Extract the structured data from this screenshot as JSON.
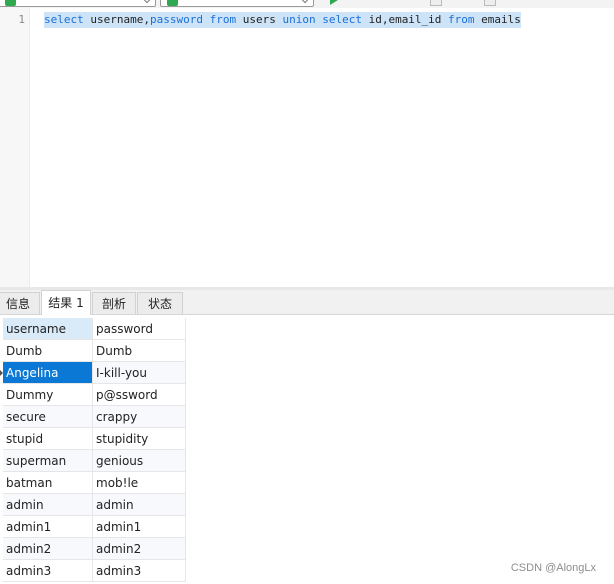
{
  "editor": {
    "line_number": "1",
    "tokens": [
      {
        "text": "select",
        "kind": "kw"
      },
      {
        "text": " username,",
        "kind": "id"
      },
      {
        "text": "password",
        "kind": "kw"
      },
      {
        "text": " ",
        "kind": "id"
      },
      {
        "text": "from",
        "kind": "kw"
      },
      {
        "text": " users ",
        "kind": "id"
      },
      {
        "text": "union",
        "kind": "kw"
      },
      {
        "text": " ",
        "kind": "id"
      },
      {
        "text": "select",
        "kind": "kw"
      },
      {
        "text": " id,email_id ",
        "kind": "id"
      },
      {
        "text": "from",
        "kind": "kw"
      },
      {
        "text": " emails",
        "kind": "id"
      }
    ],
    "keyword_color": "#1a6fd6",
    "selection_color": "#cde4f8"
  },
  "tabs": [
    {
      "label": "信息",
      "active": false
    },
    {
      "label": "结果 1",
      "active": true
    },
    {
      "label": "剖析",
      "active": false
    },
    {
      "label": "状态",
      "active": false
    }
  ],
  "result": {
    "columns": [
      "username",
      "password"
    ],
    "rows": [
      [
        "Dumb",
        "Dumb"
      ],
      [
        "Angelina",
        "I-kill-you"
      ],
      [
        "Dummy",
        "p@ssword"
      ],
      [
        "secure",
        "crappy"
      ],
      [
        "stupid",
        "stupidity"
      ],
      [
        "superman",
        "genious"
      ],
      [
        "batman",
        "mob!le"
      ],
      [
        "admin",
        "admin"
      ],
      [
        "admin1",
        "admin1"
      ],
      [
        "admin2",
        "admin2"
      ],
      [
        "admin3",
        "admin3"
      ]
    ],
    "selected_row": 1,
    "selection_color": "#0a78d4"
  },
  "watermark": "CSDN @AlongLx"
}
